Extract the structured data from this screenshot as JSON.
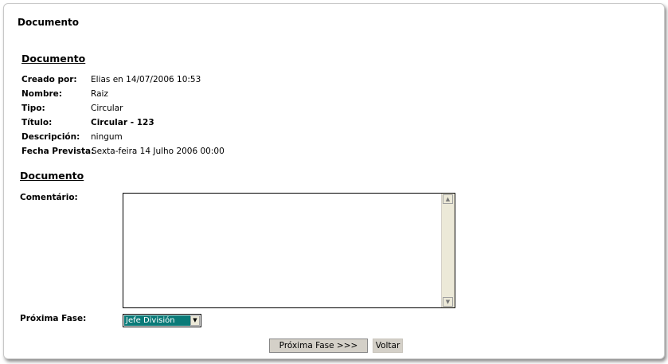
{
  "page_title": "Documento",
  "section1_heading": "Documento",
  "details": {
    "creado_por": {
      "label": "Creado por:",
      "value": "Elias en 14/07/2006 10:53"
    },
    "nombre": {
      "label": "Nombre:",
      "value": "Raiz"
    },
    "tipo": {
      "label": "Tipo:",
      "value": "Circular"
    },
    "titulo": {
      "label": "Título:",
      "value": "Circular - 123"
    },
    "descripcion": {
      "label": "Descripción:",
      "value": "ningum"
    },
    "fecha_prevista": {
      "label": "Fecha Prevista:",
      "value": "Sexta-feira 14 Julho 2006 00:00"
    }
  },
  "section2_heading": "Documento",
  "form": {
    "comment_label": "Comentário:",
    "comment_value": "",
    "next_phase_label": "Próxima Fase:",
    "next_phase_selected": "Jefe División",
    "next_button": "Próxima Fase >>>",
    "back_button": "Voltar"
  },
  "icons": {
    "scroll_up": "scroll-up-arrow-icon",
    "scroll_down": "scroll-down-arrow-icon",
    "dropdown": "chevron-down-icon"
  },
  "colors": {
    "selected_option_bg": "#0a7a78",
    "button_bg": "#d4d0c8"
  }
}
